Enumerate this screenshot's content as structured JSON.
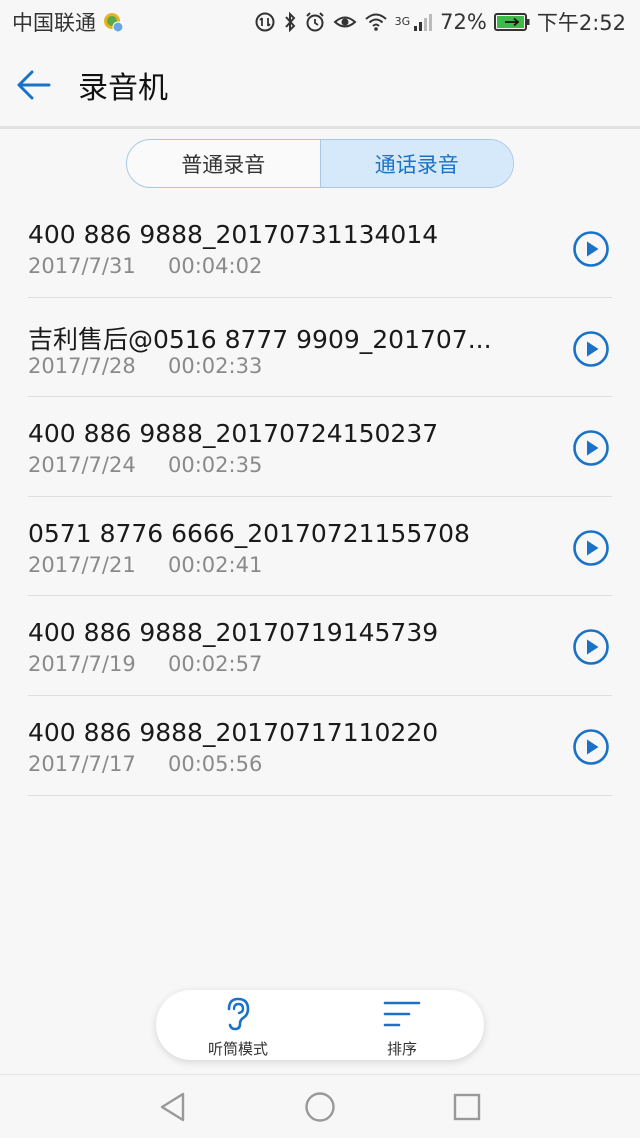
{
  "status_bar": {
    "carrier": "中国联通",
    "network": "3G",
    "battery": "72%",
    "time": "下午2:52",
    "icons": [
      "carrier-badge-icon",
      "data-saver-icon",
      "bluetooth-icon",
      "alarm-icon",
      "eye-icon",
      "wifi-icon",
      "signal-icon",
      "battery-icon"
    ]
  },
  "app_bar": {
    "title": "录音机",
    "back_icon": "arrow-left-icon"
  },
  "tabs": {
    "normal": "普通录音",
    "call": "通话录音",
    "selected": "call"
  },
  "recordings": [
    {
      "name": "400 886 9888_20170731134014",
      "date": "2017/7/31",
      "duration": "00:04:02"
    },
    {
      "name": "吉利售后@0516 8777 9909_201707...",
      "date": "2017/7/28",
      "duration": "00:02:33"
    },
    {
      "name": "400 886 9888_20170724150237",
      "date": "2017/7/24",
      "duration": "00:02:35"
    },
    {
      "name": "0571 8776 6666_20170721155708",
      "date": "2017/7/21",
      "duration": "00:02:41"
    },
    {
      "name": "400 886 9888_20170719145739",
      "date": "2017/7/19",
      "duration": "00:02:57"
    },
    {
      "name": "400 886 9888_20170717110220",
      "date": "2017/7/17",
      "duration": "00:05:56"
    }
  ],
  "toolbar": {
    "earpiece_label": "听筒模式",
    "sort_label": "排序"
  },
  "colors": {
    "accent": "#1a72c8",
    "background": "#f7f7f7",
    "secondary_text": "#8a8a8a"
  }
}
